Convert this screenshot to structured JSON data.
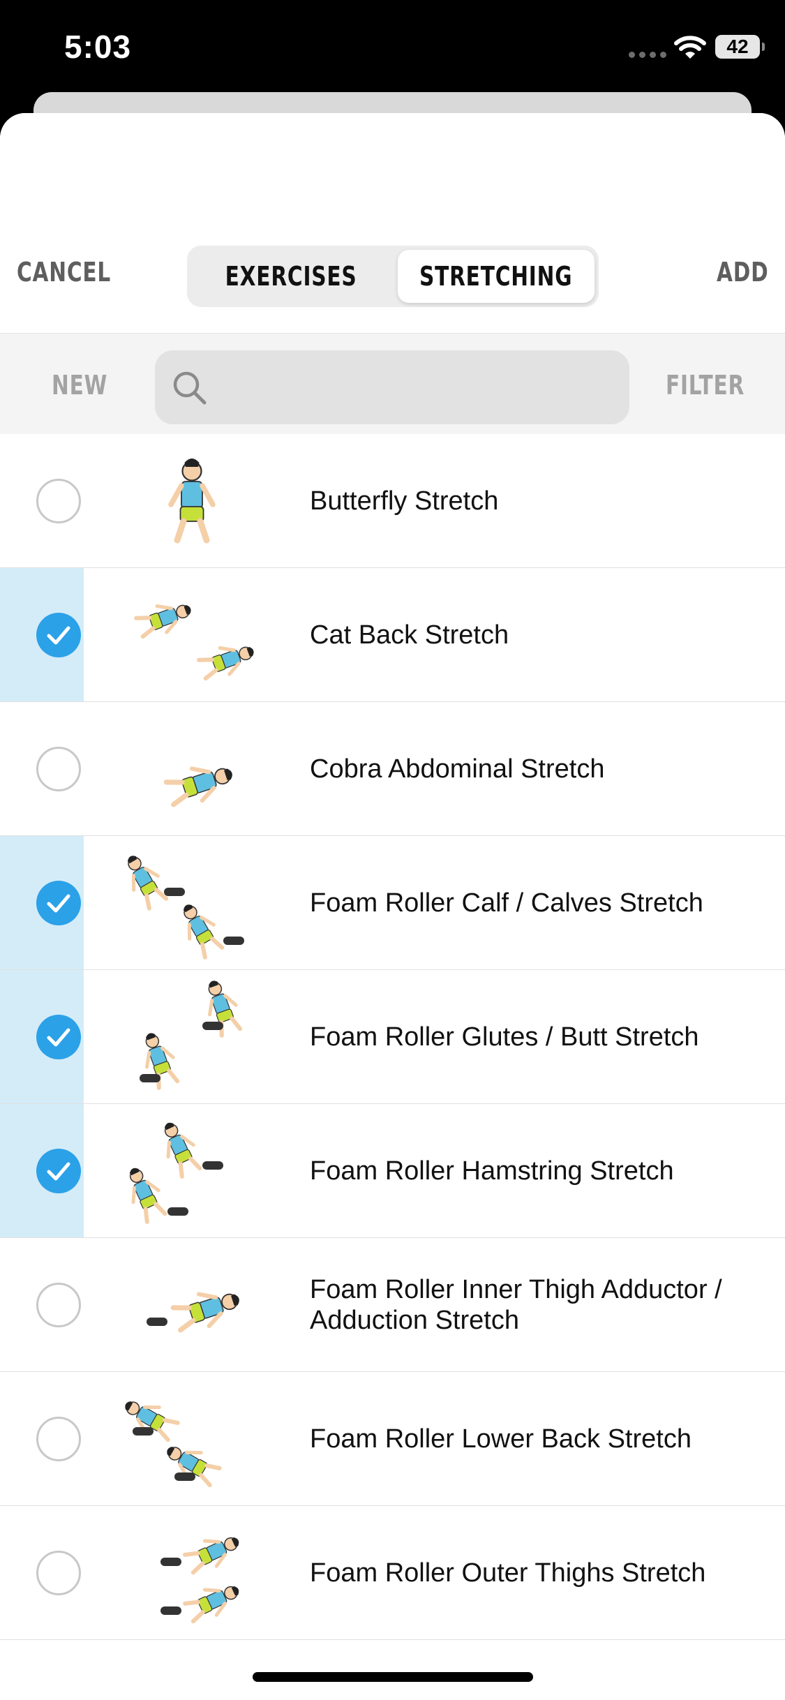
{
  "status_bar": {
    "time": "5:03",
    "battery": "42",
    "icons": [
      "signal-icon",
      "wifi-icon",
      "battery-icon"
    ]
  },
  "header": {
    "cancel_label": "CANCEL",
    "add_label": "ADD",
    "segments": [
      {
        "label": "EXERCISES",
        "selected": false
      },
      {
        "label": "STRETCHING",
        "selected": true
      }
    ]
  },
  "search": {
    "new_label": "NEW",
    "filter_label": "FILTER",
    "placeholder": "",
    "value": ""
  },
  "colors": {
    "accent": "#2ba1e8",
    "selected_band": "#d4ecf8",
    "shirt": "#5fbfe0",
    "shorts": "#c6e03a"
  },
  "items": [
    {
      "name": "Butterfly Stretch",
      "checked": false
    },
    {
      "name": "Cat Back Stretch",
      "checked": true
    },
    {
      "name": "Cobra Abdominal Stretch",
      "checked": false
    },
    {
      "name": "Foam Roller Calf / Calves Stretch",
      "checked": true
    },
    {
      "name": "Foam Roller Glutes / Butt Stretch",
      "checked": true
    },
    {
      "name": "Foam Roller Hamstring Stretch",
      "checked": true
    },
    {
      "name": "Foam Roller Inner Thigh Adductor / Adduction Stretch",
      "checked": false
    },
    {
      "name": "Foam Roller Lower Back Stretch",
      "checked": false
    },
    {
      "name": "Foam Roller Outer Thighs Stretch",
      "checked": false
    }
  ]
}
